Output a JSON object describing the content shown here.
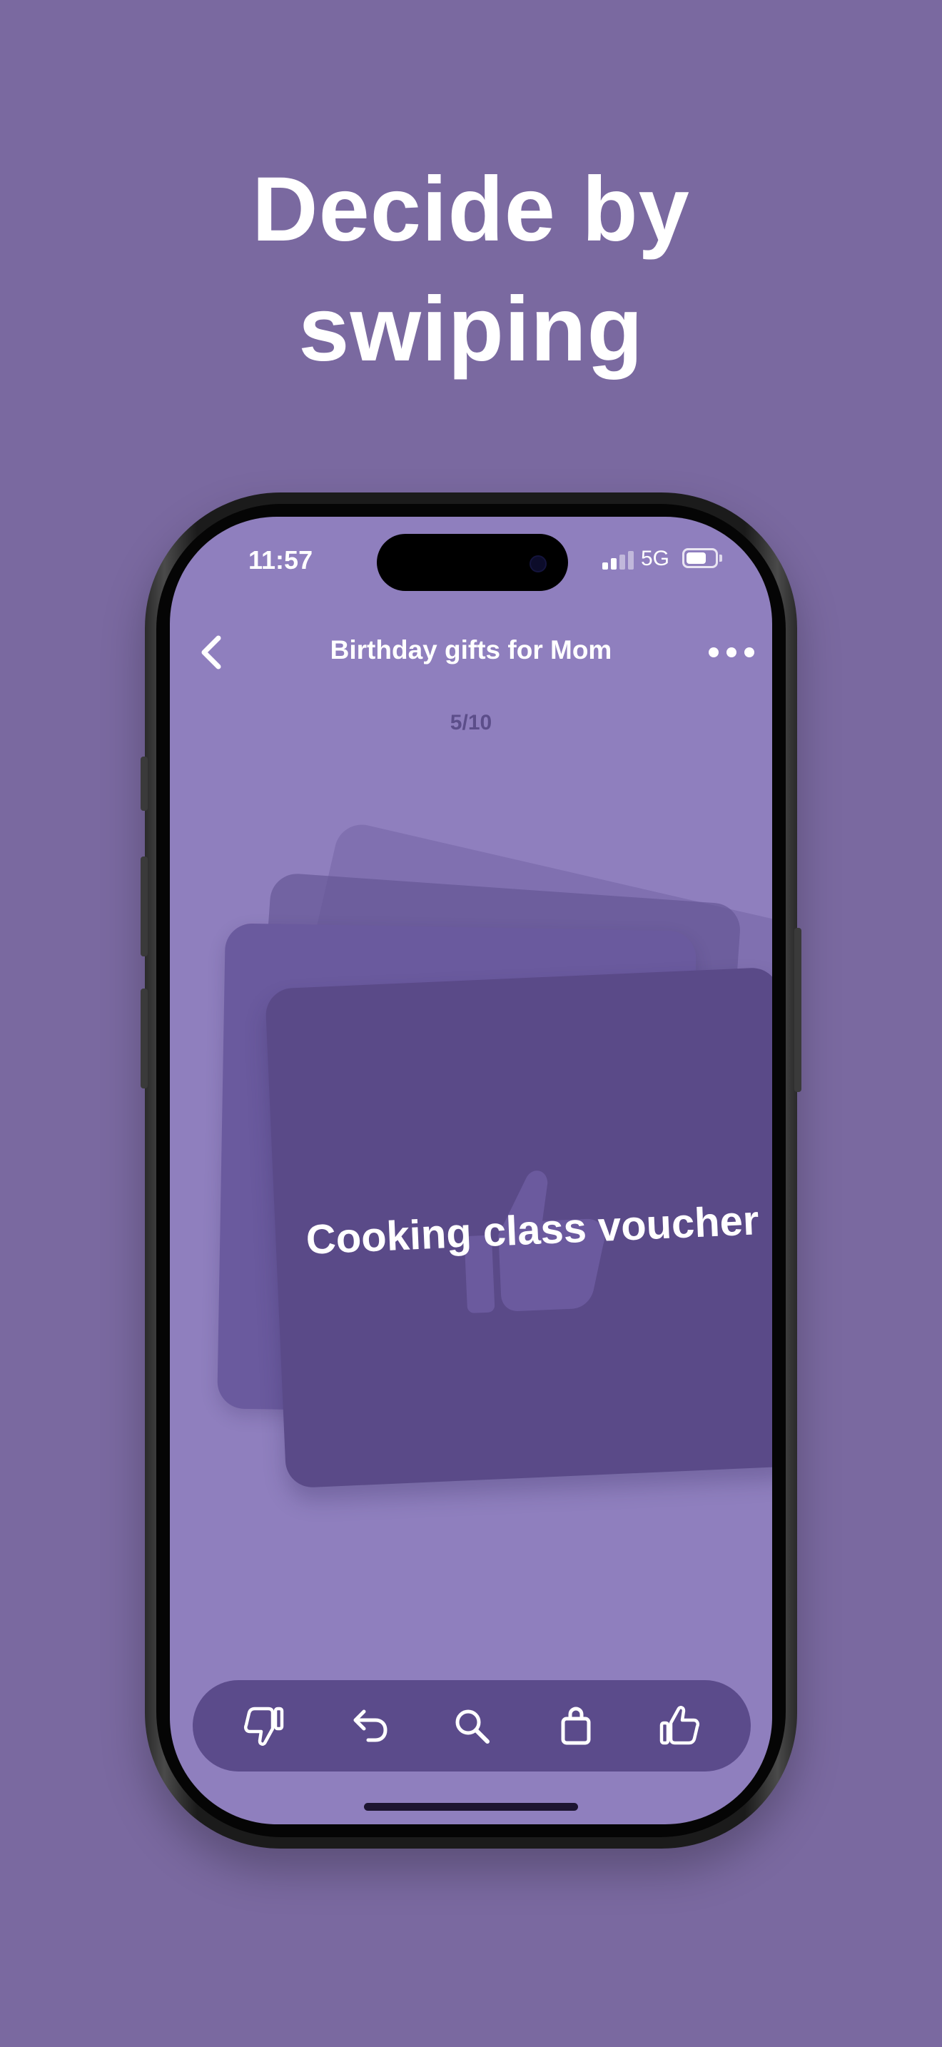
{
  "headline": {
    "line1": "Decide by",
    "line2": "swiping"
  },
  "status_bar": {
    "time": "11:57",
    "network": "5G",
    "signal_bars_active": 2,
    "signal_bars_total": 4,
    "battery_level": 0.7
  },
  "nav": {
    "back_icon": "chevron-left-icon",
    "title": "Birthday gifts for Mom",
    "more_icon": "ellipsis-icon"
  },
  "progress": {
    "counter": "5/10"
  },
  "card": {
    "title": "Cooking class voucher",
    "overlay_icon": "thumbs-up-icon"
  },
  "actions": [
    {
      "name": "dislike",
      "icon": "thumbs-down-icon"
    },
    {
      "name": "undo",
      "icon": "undo-icon"
    },
    {
      "name": "search",
      "icon": "search-icon"
    },
    {
      "name": "shop",
      "icon": "shopping-bag-icon"
    },
    {
      "name": "like",
      "icon": "thumbs-up-icon"
    }
  ],
  "colors": {
    "page_background": "#7a69a0",
    "screen_background": "#8f7fbe",
    "card_front": "#5a4a88",
    "action_bar": "#5b4b8b",
    "text_primary": "#ffffff",
    "counter_text": "#5c4e8a"
  }
}
